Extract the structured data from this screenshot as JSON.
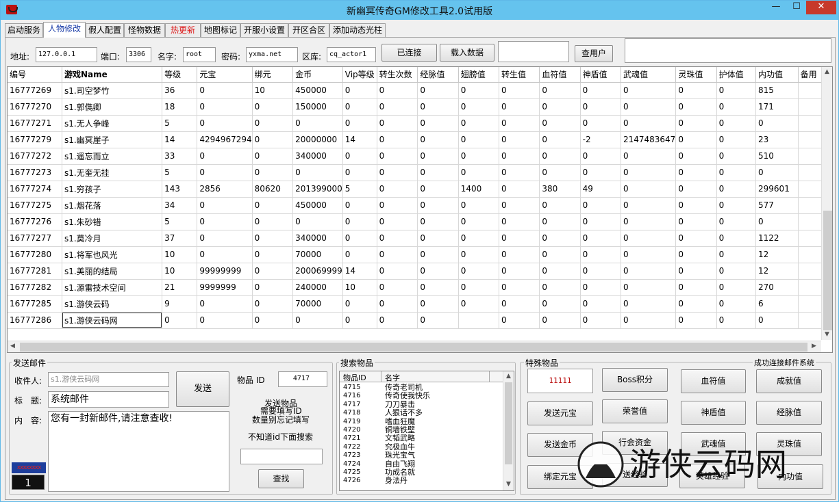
{
  "window": {
    "title": "新幽冥传奇GM修改工具2.0试用版",
    "min": "—",
    "max": "☐",
    "close": "✕"
  },
  "tabs": [
    "启动服务",
    "人物修改",
    "假人配置",
    "怪物数据",
    "热更新",
    "地图标记",
    "开服小设置",
    "开区合区",
    "添加动态光柱"
  ],
  "connection": {
    "address_label": "地址:",
    "address": "127.0.0.1",
    "port_label": "端口:",
    "port": "3306",
    "user_label": "名字:",
    "user": "root",
    "password_label": "密码:",
    "password": "yxma.net",
    "db_label": "区库:",
    "db": "cq_actor1",
    "connected_button": "已连接",
    "load_button": "载入数据",
    "query_user_button": "查用户",
    "extra_value": "",
    "status_value": ""
  },
  "table": {
    "columns": [
      "编号",
      "游戏Name",
      "等级",
      "元宝",
      "绑元",
      "金币",
      "Vip等级",
      "转生次数",
      "经脉值",
      "翅膀值",
      "转生值",
      "血符值",
      "神盾值",
      "武魂值",
      "灵珠值",
      "护体值",
      "内功值",
      "备用"
    ],
    "rows": [
      [
        "16777269",
        "s1.司空梦竹",
        "36",
        "0",
        "10",
        "450000",
        "0",
        "0",
        "0",
        "0",
        "0",
        "0",
        "0",
        "0",
        "0",
        "0",
        "815",
        ""
      ],
      [
        "16777270",
        "s1.郭儁卿",
        "18",
        "0",
        "0",
        "150000",
        "0",
        "0",
        "0",
        "0",
        "0",
        "0",
        "0",
        "0",
        "0",
        "0",
        "171",
        ""
      ],
      [
        "16777271",
        "s1.无人争峰",
        "5",
        "0",
        "0",
        "0",
        "0",
        "0",
        "0",
        "0",
        "0",
        "0",
        "0",
        "0",
        "0",
        "0",
        "0",
        ""
      ],
      [
        "16777279",
        "s1.幽冥崖子",
        "14",
        "4294967294",
        "0",
        "20000000",
        "14",
        "0",
        "0",
        "0",
        "0",
        "0",
        "-2",
        "2147483647",
        "0",
        "0",
        "23",
        ""
      ],
      [
        "16777272",
        "s1.遥忘而立",
        "33",
        "0",
        "0",
        "340000",
        "0",
        "0",
        "0",
        "0",
        "0",
        "0",
        "0",
        "0",
        "0",
        "0",
        "510",
        ""
      ],
      [
        "16777273",
        "s1.无奎无挂",
        "5",
        "0",
        "0",
        "0",
        "0",
        "0",
        "0",
        "0",
        "0",
        "0",
        "0",
        "0",
        "0",
        "0",
        "0",
        ""
      ],
      [
        "16777274",
        "s1.穷孩子",
        "143",
        "2856",
        "80620",
        "201399000",
        "5",
        "0",
        "0",
        "1400",
        "0",
        "380",
        "49",
        "0",
        "0",
        "0",
        "299601",
        ""
      ],
      [
        "16777275",
        "s1.烟花落",
        "34",
        "0",
        "0",
        "450000",
        "0",
        "0",
        "0",
        "0",
        "0",
        "0",
        "0",
        "0",
        "0",
        "0",
        "577",
        ""
      ],
      [
        "16777276",
        "s1.朱砂错",
        "5",
        "0",
        "0",
        "0",
        "0",
        "0",
        "0",
        "0",
        "0",
        "0",
        "0",
        "0",
        "0",
        "0",
        "0",
        ""
      ],
      [
        "16777277",
        "s1.莫冷月",
        "37",
        "0",
        "0",
        "340000",
        "0",
        "0",
        "0",
        "0",
        "0",
        "0",
        "0",
        "0",
        "0",
        "0",
        "1122",
        ""
      ],
      [
        "16777280",
        "s1.将军也风光",
        "10",
        "0",
        "0",
        "70000",
        "0",
        "0",
        "0",
        "0",
        "0",
        "0",
        "0",
        "0",
        "0",
        "0",
        "12",
        ""
      ],
      [
        "16777281",
        "s1.美丽的结局",
        "10",
        "99999999",
        "0",
        "200069999",
        "14",
        "0",
        "0",
        "0",
        "0",
        "0",
        "0",
        "0",
        "0",
        "0",
        "12",
        ""
      ],
      [
        "16777282",
        "s1.源雷技术空间",
        "21",
        "9999999",
        "0",
        "240000",
        "10",
        "0",
        "0",
        "0",
        "0",
        "0",
        "0",
        "0",
        "0",
        "0",
        "270",
        ""
      ],
      [
        "16777285",
        "s1.游侠云码",
        "9",
        "0",
        "0",
        "70000",
        "0",
        "0",
        "0",
        "0",
        "0",
        "0",
        "0",
        "0",
        "0",
        "0",
        "6",
        ""
      ],
      [
        "16777286",
        "s1.游侠云码网",
        "0",
        "0",
        "0",
        "0",
        "0",
        "0",
        "0",
        "",
        "0",
        "0",
        "0",
        "0",
        "0",
        "0",
        "0",
        ""
      ]
    ]
  },
  "mail": {
    "group_title": "发送邮件",
    "recipient_label": "收件人:",
    "recipient": "s1.游侠云码网",
    "subject_label": "标　题:",
    "subject": "系统邮件",
    "content_label": "内　容:",
    "content": "您有一封新邮件,请注意查收!",
    "send_button": "发送",
    "item_id_label": "物品 ID",
    "item_id": "4717",
    "hint1": "发送物品",
    "hint2": "需要填写ID",
    "hint3": "数量别忘记填写",
    "hint4": "不知道id下面搜索",
    "search_value": "",
    "find_button": "查找",
    "counter_top": "xxxxxxxx",
    "counter_bottom": "1"
  },
  "search": {
    "group_title": "搜索物品",
    "col_id": "物品ID",
    "col_name": "名字",
    "items": [
      {
        "id": "4715",
        "name": "传奇老司机"
      },
      {
        "id": "4716",
        "name": "传奇使我快乐"
      },
      {
        "id": "4717",
        "name": "刀刀暴击"
      },
      {
        "id": "4718",
        "name": "人狠话不多"
      },
      {
        "id": "4719",
        "name": "嗜血狂魔"
      },
      {
        "id": "4720",
        "name": "铜墙铁壁"
      },
      {
        "id": "4721",
        "name": "文韬武略"
      },
      {
        "id": "4722",
        "name": "究极血牛"
      },
      {
        "id": "4723",
        "name": "珠光宝气"
      },
      {
        "id": "4724",
        "name": "自由飞翔"
      },
      {
        "id": "4725",
        "name": "功成名就"
      },
      {
        "id": "4726",
        "name": "身法丹"
      }
    ]
  },
  "special": {
    "group_title": "特殊物品",
    "status": "成功连接邮件系统",
    "value": "11111",
    "buttons": [
      "Boss积分",
      "血符值",
      "成就值",
      "发送元宝",
      "荣誉值",
      "神盾值",
      "经脉值",
      "发送金币",
      "行会资金",
      "武魂值",
      "灵珠值",
      "绑定元宝",
      "送经验",
      "英雄经验",
      "内功值"
    ]
  },
  "watermark": {
    "text": "游侠云码网"
  }
}
